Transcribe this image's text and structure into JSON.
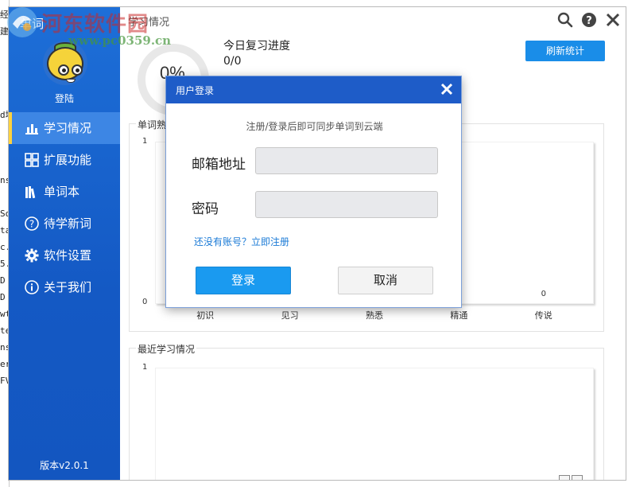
{
  "background_app": {
    "strip_lines": [
      "经",
      "建",
      "",
      "",
      "",
      "",
      "d地",
      "",
      "",
      "",
      "ns",
      "",
      "So",
      "ta",
      "c.",
      "5.1",
      "D",
      "D",
      "wt",
      "te",
      "ns",
      "er.",
      "FV"
    ]
  },
  "sidebar": {
    "app_title": "单词",
    "login_label": "登陆",
    "items": [
      {
        "label": "学习情况",
        "icon": "bar-chart-icon",
        "active": true
      },
      {
        "label": "扩展功能",
        "icon": "grid-icon",
        "active": false
      },
      {
        "label": "单词本",
        "icon": "books-icon",
        "active": false
      },
      {
        "label": "待学新词",
        "icon": "question-icon",
        "active": false
      },
      {
        "label": "软件设置",
        "icon": "gear-icon",
        "active": false
      },
      {
        "label": "关于我们",
        "icon": "info-icon",
        "active": false
      }
    ],
    "version": "版本v2.0.1"
  },
  "main": {
    "window_title": "学习情况",
    "progress_percent": "0%",
    "today_title": "今日复习进度",
    "today_value": "0/0",
    "refresh_button": "刷新统计",
    "proficiency_panel_title": "单词熟悉",
    "recent_panel_title": "最近学习情况",
    "chart_top_label": "1",
    "chart_bottom_label": "0",
    "recent_top_label": "1"
  },
  "chart_data": {
    "type": "bar",
    "title": "单词熟悉",
    "categories": [
      "初识",
      "见习",
      "熟悉",
      "精通",
      "传说"
    ],
    "values": [
      0,
      0,
      0,
      0,
      0
    ],
    "value_labels": [
      "",
      "",
      "",
      "",
      "0"
    ],
    "ylim": [
      0,
      1
    ],
    "yticks": [
      "1",
      "0"
    ]
  },
  "dialog": {
    "title": "用户登录",
    "hint": "注册/登录后即可同步单词到云端",
    "email_label": "邮箱地址",
    "email_value": "",
    "password_label": "密码",
    "password_value": "",
    "register_link": "还没有账号？立即注册",
    "login_button": "登录",
    "cancel_button": "取消"
  },
  "watermark": {
    "text": "河东软件园",
    "url": "www.pc0359.cn"
  },
  "colors": {
    "sidebar": "#1459c4",
    "accent": "#1a8de8",
    "dialog_header": "#1e5cc8",
    "active_marker": "#ffd23f"
  }
}
